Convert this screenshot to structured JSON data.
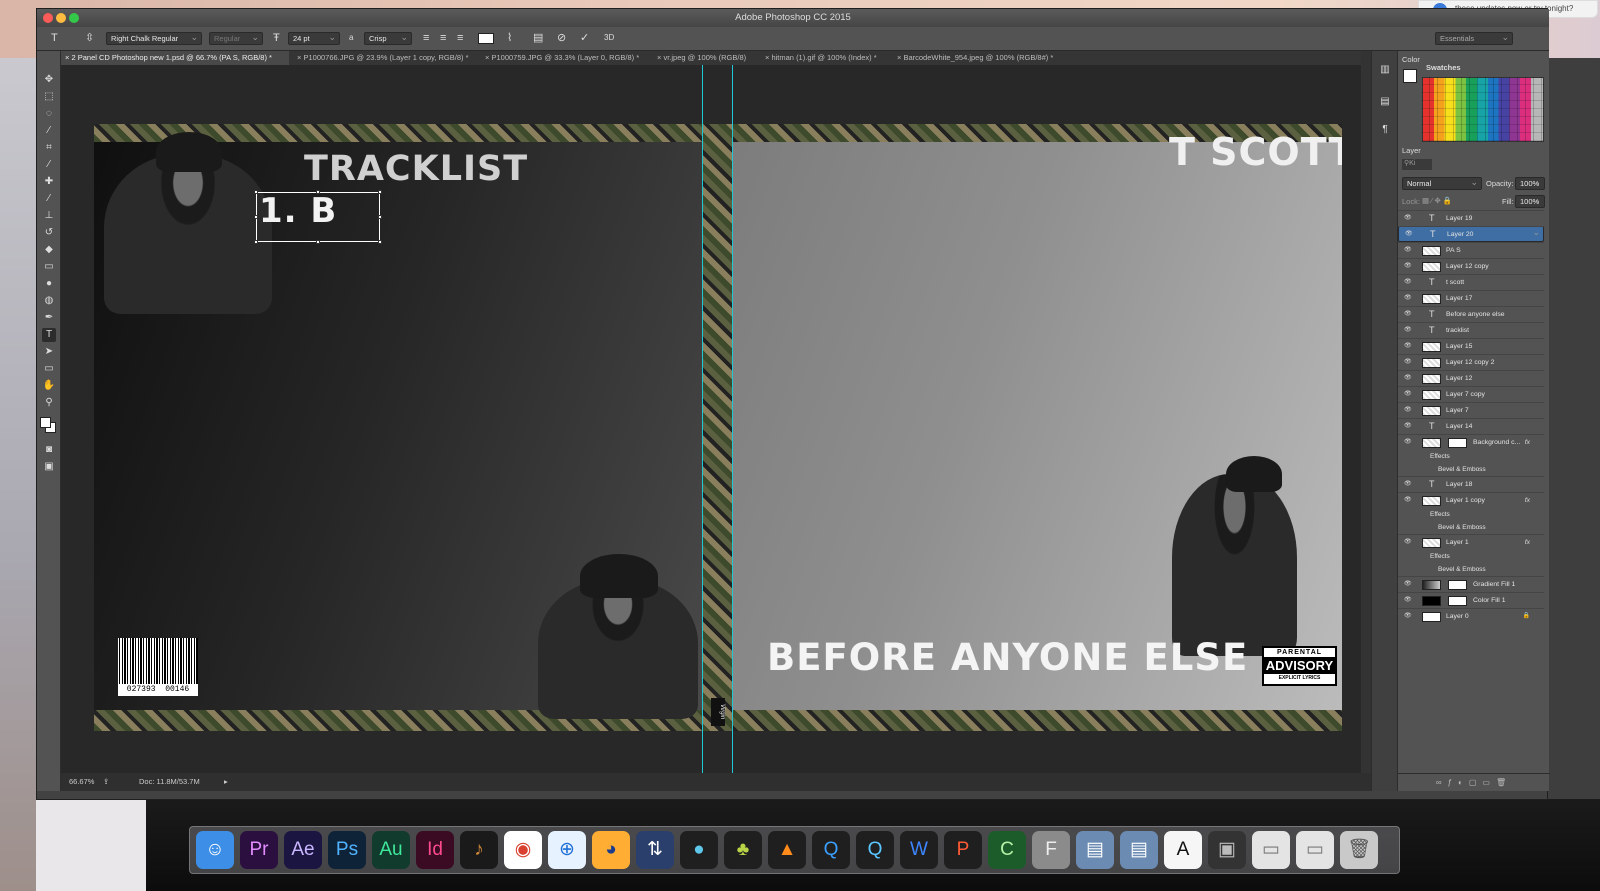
{
  "app_title": "Adobe Photoshop CC 2015",
  "notification_text": "these updates now or try tonight?",
  "options_bar": {
    "font_family": "Right Chalk Regular",
    "font_style": "Regular",
    "font_size": "24 pt",
    "aa_prefix": "a",
    "antialias": "Crisp",
    "three_d": "3D",
    "workspace": "Essentials"
  },
  "tabs": [
    "2 Panel CD Photoshop new 1.psd @ 66.7% (PA S, RGB/8) *",
    "P1000766.JPG @ 23.9% (Layer 1 copy, RGB/8) *",
    "P1000759.JPG @ 33.3% (Layer 0, RGB/8) *",
    "vr.jpeg @ 100% (RGB/8)",
    "hitman (1).gif @ 100% (Index) *",
    "BarcodeWhite_954.jpeg @ 100% (RGB/8#) *"
  ],
  "document": {
    "tracklist_title": "TRACKLIST",
    "editing_text": "1. B",
    "artist": "T SCOTT",
    "album_title": "BEFORE ANYONE ELSE",
    "barcode_left": "027393",
    "barcode_right": "00146",
    "advisory_top": "PARENTAL",
    "advisory_mid": "ADVISORY",
    "advisory_bottom": "EXPLICIT LYRICS",
    "spine_label": "Virgin"
  },
  "status": {
    "zoom": "66.67%",
    "doc_size": "Doc: 11.8M/53.7M"
  },
  "panels": {
    "color_tab": "Color",
    "swatches_tab": "Swatches",
    "layers_tab": "Layer",
    "filter_prefix": "Ki",
    "blend_mode": "Normal",
    "opacity_label": "Opacity:",
    "opacity_value": "100%",
    "lock_label": "Lock:",
    "fill_label": "Fill:",
    "fill_value": "100%"
  },
  "layers": [
    {
      "name": "Layer 19",
      "kind": "text"
    },
    {
      "name": "Layer 20",
      "kind": "text",
      "selected": true
    },
    {
      "name": "PA S",
      "kind": "pixel"
    },
    {
      "name": "Layer 12 copy",
      "kind": "pixel"
    },
    {
      "name": "t scott",
      "kind": "text"
    },
    {
      "name": "Layer 17",
      "kind": "pixel"
    },
    {
      "name": "Before  anyone  else",
      "kind": "text"
    },
    {
      "name": "tracklist",
      "kind": "text"
    },
    {
      "name": "Layer 15",
      "kind": "pixel"
    },
    {
      "name": "Layer 12 copy 2",
      "kind": "pixel"
    },
    {
      "name": "Layer 12",
      "kind": "pixel"
    },
    {
      "name": "Layer 7 copy",
      "kind": "pixel"
    },
    {
      "name": "Layer 7",
      "kind": "pixel"
    },
    {
      "name": "Layer 14",
      "kind": "text"
    },
    {
      "name": "Background c...",
      "kind": "masked",
      "fx": "fx"
    },
    {
      "name": "Effects",
      "kind": "effects"
    },
    {
      "name": "Bevel & Emboss",
      "kind": "effect"
    },
    {
      "name": "Layer 18",
      "kind": "text"
    },
    {
      "name": "Layer 1 copy",
      "kind": "pixel",
      "fx": "fx"
    },
    {
      "name": "Effects",
      "kind": "effects"
    },
    {
      "name": "Bevel & Emboss",
      "kind": "effect"
    },
    {
      "name": "Layer 1",
      "kind": "pixel",
      "fx": "fx"
    },
    {
      "name": "Effects",
      "kind": "effects"
    },
    {
      "name": "Bevel & Emboss",
      "kind": "effect"
    },
    {
      "name": "Gradient Fill 1",
      "kind": "adjust"
    },
    {
      "name": "Color Fill 1",
      "kind": "adjust"
    },
    {
      "name": "Layer 0",
      "kind": "locked"
    }
  ],
  "dock": [
    {
      "name": "finder",
      "label": "☺",
      "bg": "#3d8ee6",
      "fg": "#ffffff"
    },
    {
      "name": "premiere",
      "label": "Pr",
      "bg": "#2a0f3f",
      "fg": "#e28cff"
    },
    {
      "name": "after-effects",
      "label": "Ae",
      "bg": "#1b1542",
      "fg": "#c9b6ff"
    },
    {
      "name": "photoshop",
      "label": "Ps",
      "bg": "#0f2338",
      "fg": "#4fb3ff"
    },
    {
      "name": "audition",
      "label": "Au",
      "bg": "#113b2c",
      "fg": "#3ee89b"
    },
    {
      "name": "indesign",
      "label": "Id",
      "bg": "#3a0b22",
      "fg": "#ff4a8e"
    },
    {
      "name": "garageband",
      "label": "♪",
      "bg": "#1a1a1a",
      "fg": "#d28a3b"
    },
    {
      "name": "chrome",
      "label": "◉",
      "bg": "#ffffff",
      "fg": "#d9402f"
    },
    {
      "name": "safari",
      "label": "⊕",
      "bg": "#e6f2ff",
      "fg": "#1f6fd6"
    },
    {
      "name": "firefox",
      "label": "◕",
      "bg": "#ffad33",
      "fg": "#1b3c8c"
    },
    {
      "name": "migration",
      "label": "⇅",
      "bg": "#2a3f6b",
      "fg": "#ffffff"
    },
    {
      "name": "skype-ish",
      "label": "●",
      "bg": "#1f1f1f",
      "fg": "#5fc8ea"
    },
    {
      "name": "fruity",
      "label": "♣",
      "bg": "#1f1f1f",
      "fg": "#b9d447"
    },
    {
      "name": "vlc",
      "label": "▲",
      "bg": "#1f1f1f",
      "fg": "#ff8c1a"
    },
    {
      "name": "quicktime",
      "label": "Q",
      "bg": "#1f1f1f",
      "fg": "#3aa0ff"
    },
    {
      "name": "outlook-ish",
      "label": "Q",
      "bg": "#1f1f1f",
      "fg": "#5ac8ff"
    },
    {
      "name": "word",
      "label": "W",
      "bg": "#1f1f1f",
      "fg": "#3e86ff"
    },
    {
      "name": "powerpoint",
      "label": "P",
      "bg": "#1f1f1f",
      "fg": "#ff5a36"
    },
    {
      "name": "excel",
      "label": "C",
      "bg": "#1b5c2a",
      "fg": "#b6f0a8"
    },
    {
      "name": "fonts",
      "label": "F",
      "bg": "#8b8b8b",
      "fg": "#eeeeee"
    },
    {
      "name": "preview-1",
      "label": "▤",
      "bg": "#6b8bb3",
      "fg": "#ffffff"
    },
    {
      "name": "preview-2",
      "label": "▤",
      "bg": "#6b8bb3",
      "fg": "#ffffff"
    },
    {
      "name": "text-edit",
      "label": "A",
      "bg": "#f6f6f6",
      "fg": "#111111"
    },
    {
      "name": "photo-1",
      "label": "▣",
      "bg": "#333333",
      "fg": "#bbbbbb"
    },
    {
      "name": "doc-1",
      "label": "▭",
      "bg": "#e4e4e4",
      "fg": "#7a7a7a"
    },
    {
      "name": "doc-2",
      "label": "▭",
      "bg": "#e4e4e4",
      "fg": "#7a7a7a"
    },
    {
      "name": "trash",
      "label": "🗑",
      "bg": "#c9c9c9",
      "fg": "#555555"
    }
  ]
}
